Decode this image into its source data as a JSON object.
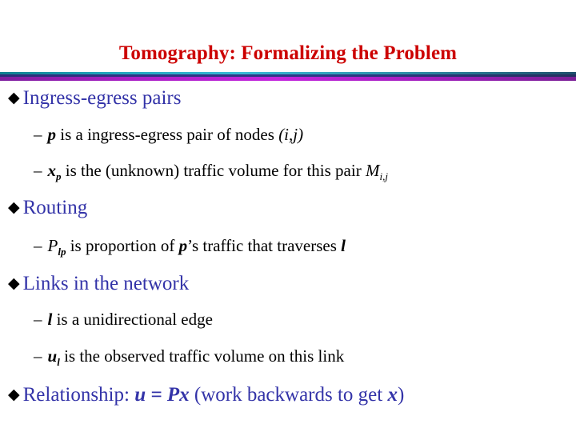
{
  "slide": {
    "title": "Tomography: Formalizing the Problem",
    "title_color": "#cc0000",
    "bullet_color": "#3333a8",
    "bullet_glyph": "◆",
    "dash_glyph": "–"
  },
  "bullets": [
    {
      "level": 1,
      "label": "Ingress-egress pairs"
    },
    {
      "level": 2,
      "var": "p",
      "text_mid": " is a ingress-egress pair of nodes ",
      "text_end": "(i,j)"
    },
    {
      "level": 2,
      "var": "x",
      "var_sub": "p",
      "text_mid": " is the (unknown) traffic volume for this pair ",
      "sym": "M",
      "sym_sub": "i,j"
    },
    {
      "level": 1,
      "label": "Routing"
    },
    {
      "level": 2,
      "sym": "P",
      "sym_sub": "lp",
      "text_a": " is proportion of ",
      "var": "p",
      "text_b": "’s traffic that traverses ",
      "var_end": "l"
    },
    {
      "level": 1,
      "label": "Links in the network"
    },
    {
      "level": 2,
      "var": "l",
      "text_mid": " is a unidirectional edge"
    },
    {
      "level": 2,
      "var": "u",
      "var_sub": "l",
      "text_mid": " is the observed traffic volume on this link"
    },
    {
      "level": 1,
      "label_a": "Relationship: ",
      "formula": "u = Px",
      "label_b": "  (work backwards to get ",
      "formula_end": "x",
      "label_c": ")"
    }
  ]
}
